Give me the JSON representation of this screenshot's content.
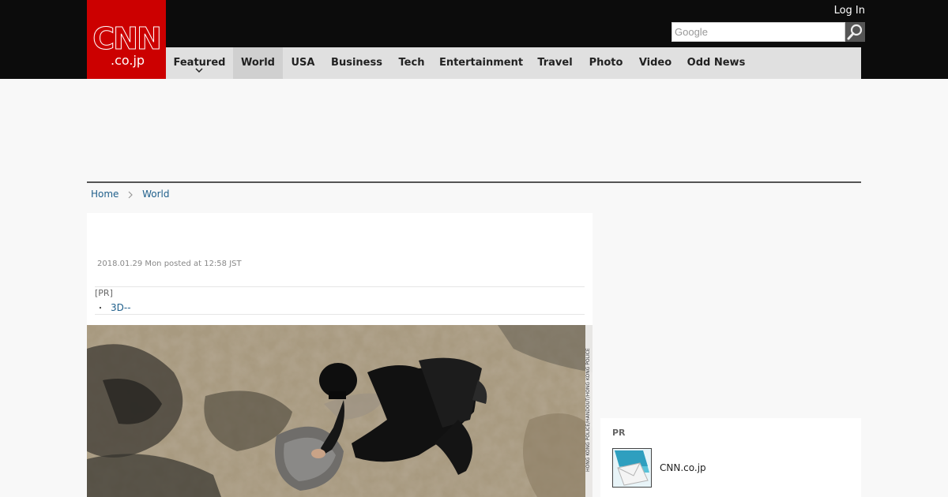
{
  "header": {
    "logo_line1": "CNN",
    "logo_line2": ".co.jp",
    "login_label": "Log In",
    "search_placeholder": "Google"
  },
  "nav": {
    "items": [
      {
        "label": "Featured"
      },
      {
        "label": "World"
      },
      {
        "label": "USA"
      },
      {
        "label": "Business"
      },
      {
        "label": "Tech"
      },
      {
        "label": "Entertainment"
      },
      {
        "label": "Travel"
      },
      {
        "label": "Photo"
      },
      {
        "label": "Video"
      },
      {
        "label": "Odd News"
      }
    ],
    "active": "World"
  },
  "breadcrumb": {
    "home": "Home",
    "current": "World"
  },
  "article": {
    "date": "2018.01.29 Mon posted at 12:58 JST",
    "pr_label": "[PR]",
    "pr_link": "3D--",
    "bullet": "・",
    "photo_credit": "HONG KONG POLICE/HANDOUT/HONG KONG POLICE"
  },
  "sidebar": {
    "pr_label": "PR",
    "item_text": "CNN.co.jp"
  },
  "colors": {
    "brand_red": "#cc0000",
    "topbar": "#0c0c0c",
    "nav_bg": "#e0e0e0",
    "link": "#1f5f8b"
  }
}
